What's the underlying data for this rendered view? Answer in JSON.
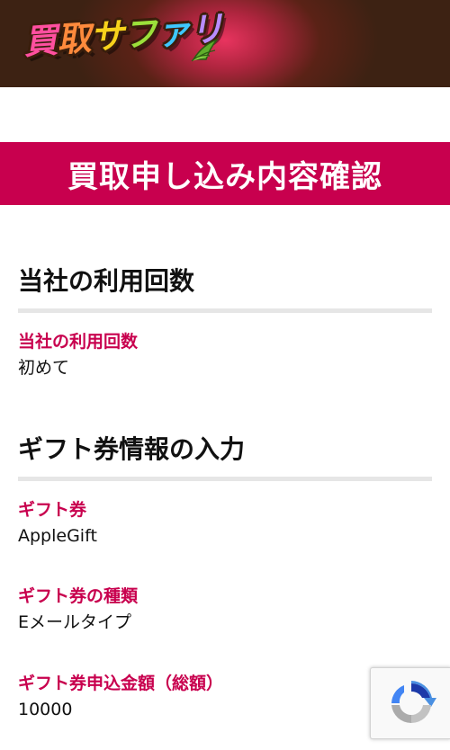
{
  "header": {
    "logo_text": "買取サファリ",
    "logo_chars": [
      "買",
      "取",
      "サ",
      "フ",
      "ァ",
      "リ"
    ],
    "background_color": "#3d2213",
    "glow_color": "#e8345f"
  },
  "title_bar": {
    "title": "買取申し込み内容確認",
    "background_color": "#c8004e"
  },
  "sections": [
    {
      "heading": "当社の利用回数",
      "fields": [
        {
          "label": "当社の利用回数",
          "value": "初めて"
        }
      ]
    },
    {
      "heading": "ギフト券情報の入力",
      "fields": [
        {
          "label": "ギフト券",
          "value": "AppleGift"
        },
        {
          "label": "ギフト券の種類",
          "value": "Eメールタイプ"
        },
        {
          "label": "ギフト券申込金額（総額）",
          "value": "10000"
        }
      ]
    }
  ],
  "recaptcha": {
    "icon": "recaptcha-icon"
  },
  "colors": {
    "accent": "#c8004e",
    "rule": "#e6e6e6",
    "text": "#111111"
  }
}
